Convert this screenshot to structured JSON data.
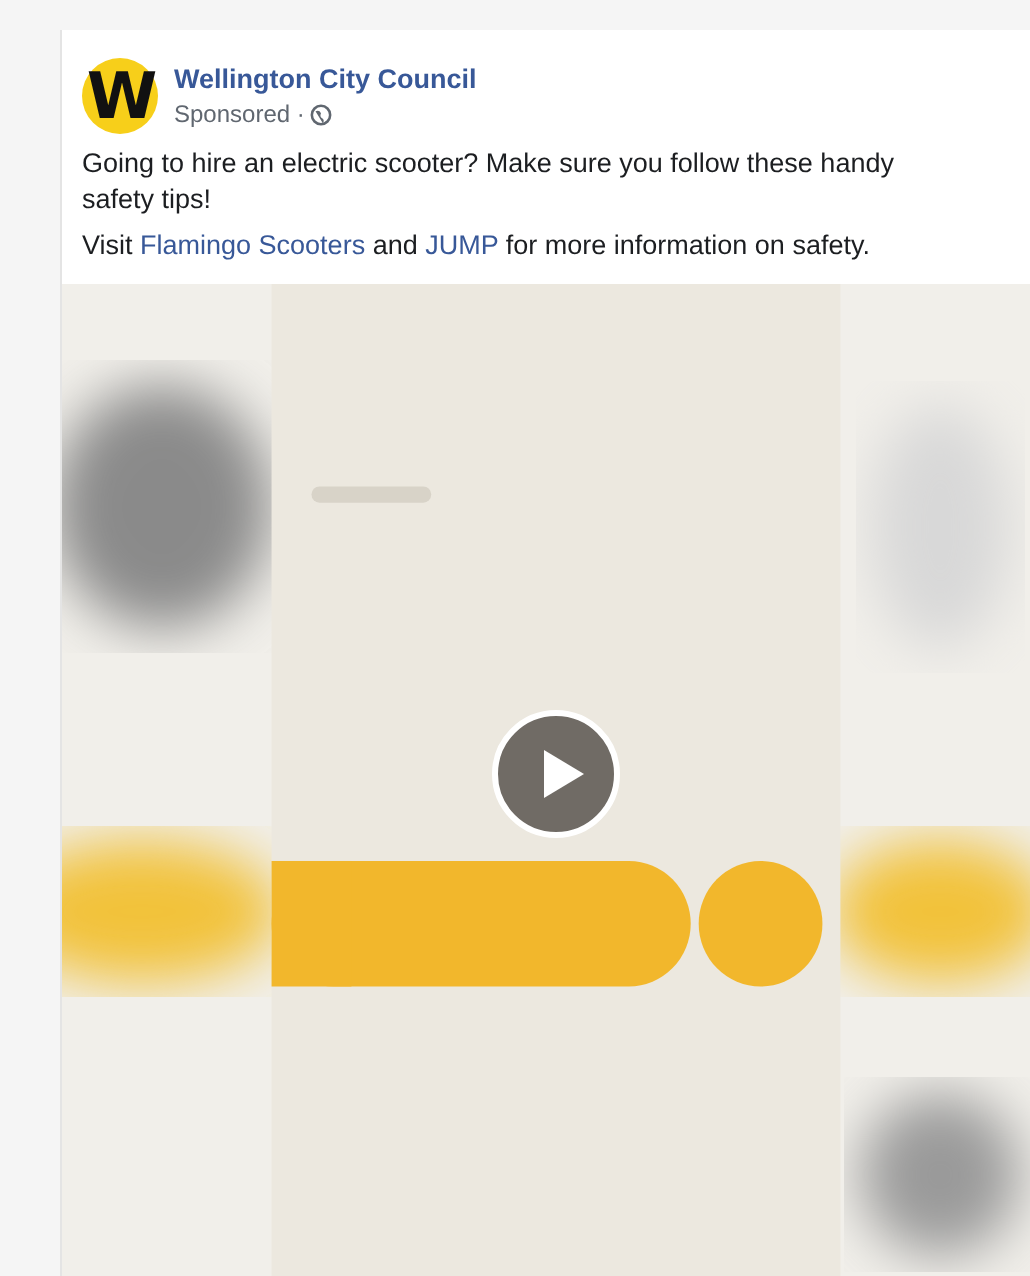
{
  "post": {
    "avatar_letter": "W",
    "author": "Wellington City Council",
    "meta": "Sponsored ·",
    "text": "Going to hire an electric scooter? Make sure you follow these handy safety tips!",
    "links_line": [
      {
        "kind": "text",
        "text": "Visit "
      },
      {
        "kind": "link",
        "text": "Flamingo Scooters"
      },
      {
        "kind": "text",
        "text": " and "
      },
      {
        "kind": "link",
        "text": "JUMP"
      },
      {
        "kind": "text",
        "text": " for more information on safety."
      }
    ]
  }
}
